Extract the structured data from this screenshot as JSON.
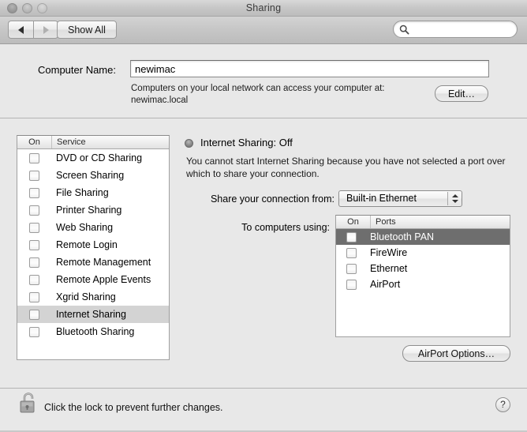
{
  "window": {
    "title": "Sharing",
    "traffic_lights": [
      "close",
      "minimize",
      "zoom"
    ]
  },
  "toolbar": {
    "back_label": "back-arrow",
    "forward_label": "forward-arrow",
    "show_all_label": "Show All",
    "search": {
      "value": "",
      "placeholder": ""
    }
  },
  "computer_name": {
    "label": "Computer Name:",
    "value": "newimac",
    "note_line1": "Computers on your local network can access your computer at:",
    "note_line2": "newimac.local",
    "edit_button": "Edit…"
  },
  "services_list": {
    "header_on": "On",
    "header_service": "Service",
    "items": [
      {
        "label": "DVD or CD Sharing",
        "checked": false,
        "selected": false
      },
      {
        "label": "Screen Sharing",
        "checked": false,
        "selected": false
      },
      {
        "label": "File Sharing",
        "checked": false,
        "selected": false
      },
      {
        "label": "Printer Sharing",
        "checked": false,
        "selected": false
      },
      {
        "label": "Web Sharing",
        "checked": false,
        "selected": false
      },
      {
        "label": "Remote Login",
        "checked": false,
        "selected": false
      },
      {
        "label": "Remote Management",
        "checked": false,
        "selected": false
      },
      {
        "label": "Remote Apple Events",
        "checked": false,
        "selected": false
      },
      {
        "label": "Xgrid Sharing",
        "checked": false,
        "selected": false
      },
      {
        "label": "Internet Sharing",
        "checked": false,
        "selected": true
      },
      {
        "label": "Bluetooth Sharing",
        "checked": false,
        "selected": false
      }
    ]
  },
  "detail": {
    "status_title": "Internet Sharing: Off",
    "status_state": "Off",
    "description": "You cannot start Internet Sharing because you have not selected a port over which to share your connection.",
    "share_from_label": "Share your connection from:",
    "share_from_value": "Built-in Ethernet",
    "to_computers_label": "To computers using:",
    "ports_header_on": "On",
    "ports_header_ports": "Ports",
    "ports": [
      {
        "label": "Bluetooth PAN",
        "checked": false,
        "selected": true
      },
      {
        "label": "FireWire",
        "checked": false,
        "selected": false
      },
      {
        "label": "Ethernet",
        "checked": false,
        "selected": false
      },
      {
        "label": "AirPort",
        "checked": false,
        "selected": false
      }
    ],
    "airport_options_button": "AirPort Options…"
  },
  "footer": {
    "lock_state": "unlocked",
    "lock_text": "Click the lock to prevent further changes.",
    "help_label": "?"
  },
  "colors": {
    "window_bg": "#e8e8e8",
    "titlebar": "#c8c8c8",
    "selection_inactive": "#d3d3d3",
    "selection_active": "#6e6e6e",
    "list_bg": "#ffffff",
    "divider": "#b4b4b4"
  }
}
